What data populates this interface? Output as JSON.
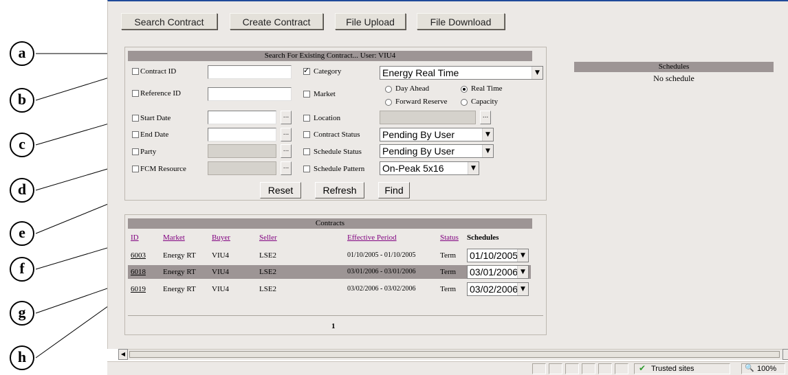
{
  "toolbar": {
    "search_contract": "Search Contract",
    "create_contract": "Create Contract",
    "file_upload": "File Upload",
    "file_download": "File Download"
  },
  "search": {
    "title": "Search For Existing Contract... User: VIU4",
    "contract_id": "Contract ID",
    "reference_id": "Reference ID",
    "start_date": "Start Date",
    "end_date": "End Date",
    "party": "Party",
    "fcm_resource": "FCM Resource",
    "category": "Category",
    "category_value": "Energy Real Time",
    "market": "Market",
    "market_options": {
      "day_ahead": "Day Ahead",
      "real_time": "Real Time",
      "forward_reserve": "Forward Reserve",
      "capacity": "Capacity"
    },
    "location": "Location",
    "contract_status": "Contract Status",
    "contract_status_value": "Pending By User",
    "schedule_status": "Schedule Status",
    "schedule_status_value": "Pending By User",
    "schedule_pattern": "Schedule Pattern",
    "schedule_pattern_value": "On-Peak 5x16",
    "reset": "Reset",
    "refresh": "Refresh",
    "find": "Find",
    "ellipsis": "..."
  },
  "schedules": {
    "title": "Schedules",
    "empty": "No schedule"
  },
  "contracts": {
    "title": "Contracts",
    "columns": {
      "id": "ID",
      "market": "Market",
      "buyer": "Buyer",
      "seller": "Seller",
      "effective_period": "Effective Period",
      "status": "Status",
      "schedules": "Schedules"
    },
    "rows": [
      {
        "id": "6003",
        "market": "Energy RT",
        "buyer": "VIU4",
        "seller": "LSE2",
        "period": "01/10/2005 - 01/10/2005",
        "status": "Term",
        "schedule": "01/10/2005"
      },
      {
        "id": "6018",
        "market": "Energy RT",
        "buyer": "VIU4",
        "seller": "LSE2",
        "period": "03/01/2006 - 03/01/2006",
        "status": "Term",
        "schedule": "03/01/2006"
      },
      {
        "id": "6019",
        "market": "Energy RT",
        "buyer": "VIU4",
        "seller": "LSE2",
        "period": "03/02/2006 - 03/02/2006",
        "status": "Term",
        "schedule": "03/02/2006"
      }
    ],
    "page": "1"
  },
  "callouts": [
    "a",
    "b",
    "c",
    "d",
    "e",
    "f",
    "g",
    "h"
  ],
  "statusbar": {
    "zone": "Trusted sites",
    "zoom": "100%"
  },
  "icons": {
    "dropdown": "chevron-down-icon",
    "trusted": "checkmark-icon",
    "zoom": "magnifier-icon"
  }
}
